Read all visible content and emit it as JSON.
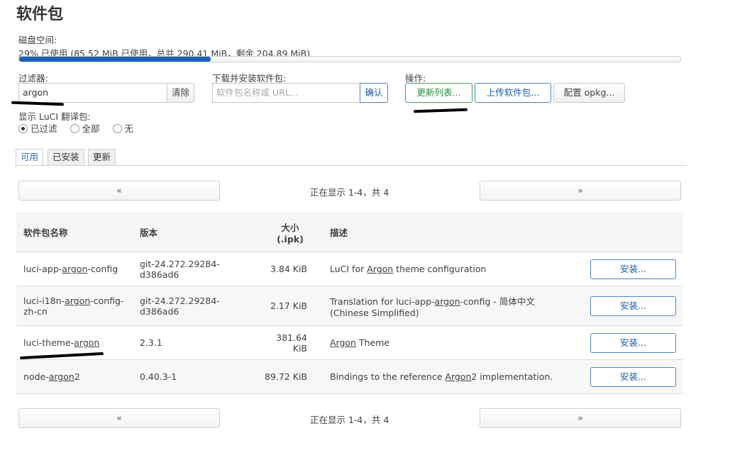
{
  "page_title": "软件包",
  "disk": {
    "label": "磁盘空间:",
    "usage_text": "29% 已使用 (85.52 MiB 已使用，总共 290.41 MiB，剩余 204.89 MiB)",
    "percent": 29
  },
  "filter": {
    "label": "过滤器:",
    "value": "argon",
    "clear_label": "清除"
  },
  "download": {
    "label": "下载并安装软件包:",
    "placeholder": "软件包名称或 URL...",
    "confirm_label": "确认"
  },
  "actions": {
    "label": "操作:",
    "update_label": "更新列表...",
    "upload_label": "上传软件包...",
    "config_label": "配置 opkg..."
  },
  "luci_lang": {
    "label": "显示 LuCI 翻译包:",
    "options": [
      "已过滤",
      "全部",
      "无"
    ],
    "selected": "已过滤"
  },
  "tabs": [
    "可用",
    "已安装",
    "更新"
  ],
  "pager": {
    "prev": "«",
    "next": "»",
    "status": "正在显示 1-4，共 4"
  },
  "table": {
    "headers": {
      "name": "软件包名称",
      "version": "版本",
      "size_line1": "大小",
      "size_line2": "(.ipk)",
      "desc": "描述"
    },
    "install_label": "安装...",
    "rows": [
      {
        "name_pre": "luci-app-",
        "name_hl": "argon",
        "name_post": "-config",
        "version": "git-24.272.29284-d386ad6",
        "size": "3.84 KiB",
        "desc_pre": "LuCI for ",
        "desc_hl": "Argon",
        "desc_post": " theme configuration"
      },
      {
        "name_pre": "luci-i18n-",
        "name_hl": "argon",
        "name_post": "-config-zh-cn",
        "version": "git-24.272.29284-d386ad6",
        "size": "2.17 KiB",
        "desc_pre": "Translation for luci-app-",
        "desc_hl": "argon",
        "desc_post": "-config - 简体中文 (Chinese Simplified)"
      },
      {
        "name_pre": "luci-theme-",
        "name_hl": "argon",
        "name_post": "",
        "version": "2.3.1",
        "size": "381.64 KiB",
        "desc_pre": "",
        "desc_hl": "Argon",
        "desc_post": " Theme"
      },
      {
        "name_pre": "node-",
        "name_hl": "argon",
        "name_post": "2",
        "version": "0.40.3-1",
        "size": "89.72 KiB",
        "desc_pre": "Bindings to the reference ",
        "desc_hl": "Argon",
        "desc_post": "2 implementation."
      }
    ]
  },
  "colors": {
    "accent": "#1c5aa8",
    "progress": "#1d5fb5",
    "update_button": "#2a8a3e"
  }
}
